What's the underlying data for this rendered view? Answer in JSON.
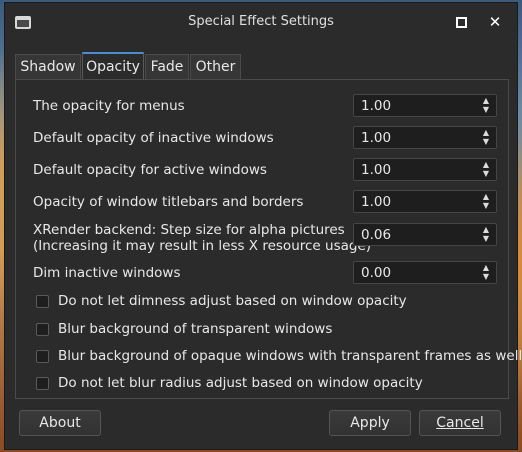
{
  "window": {
    "title": "Special Effect Settings"
  },
  "titlebar": {
    "maximize_icon": "maximize-icon",
    "close_glyph": "✕"
  },
  "tabs": [
    {
      "label": "Shadow"
    },
    {
      "label": "Opacity"
    },
    {
      "label": "Fade"
    },
    {
      "label": "Other"
    }
  ],
  "active_tab": "Opacity",
  "settings": [
    {
      "label": "The opacity for menus",
      "value": "1.00"
    },
    {
      "label": "Default opacity of inactive windows",
      "value": "1.00"
    },
    {
      "label": "Default opacity for active windows",
      "value": "1.00"
    },
    {
      "label": "Opacity of window titlebars and borders",
      "value": "1.00"
    },
    {
      "label": "XRender backend: Step size for alpha pictures",
      "label2": "(Increasing it may result in less X resource usage)",
      "value": "0.06"
    },
    {
      "label": "Dim inactive windows",
      "value": "0.00"
    }
  ],
  "checkboxes": [
    {
      "label": "Do not let dimness adjust based on window opacity"
    },
    {
      "label": "Blur background of transparent windows"
    },
    {
      "label": "Blur background of opaque windows with transparent frames as well"
    },
    {
      "label": "Do not let blur radius adjust based on window opacity"
    }
  ],
  "buttons": {
    "about": "About",
    "apply": "Apply",
    "cancel": "Cancel"
  },
  "spin_arrows": {
    "up": "▲",
    "down": "▼"
  }
}
